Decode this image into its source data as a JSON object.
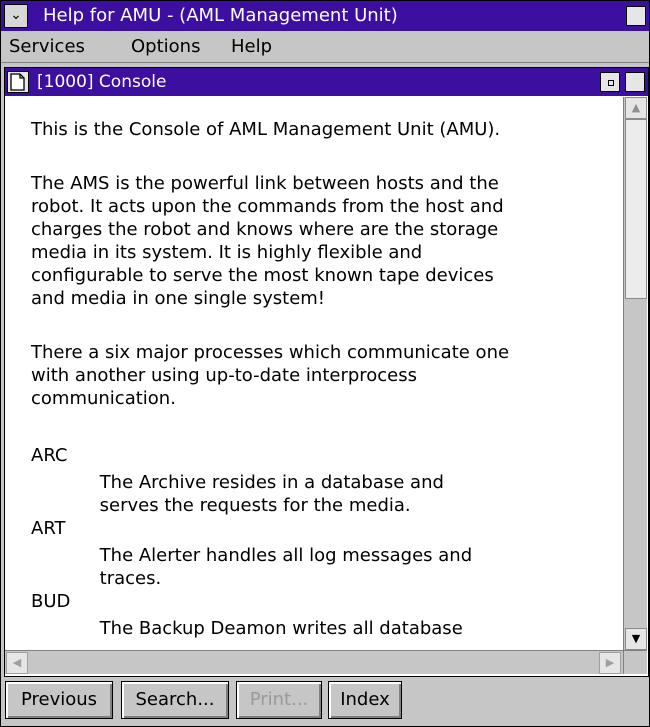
{
  "window": {
    "title": "Help for AMU - (AML Management Unit)"
  },
  "menubar": {
    "items": [
      "Services",
      "Options",
      "Help"
    ]
  },
  "help_window": {
    "title": "[1000]  Console",
    "paragraphs": [
      "This is the Console of AML Management Unit (AMU).",
      "The AMS is the powerful link between hosts and the",
      "robot. It acts upon the commands from the host and",
      "charges the robot and knows where are the storage",
      "media in its system. It is highly flexible and",
      "configurable to serve the most known tape devices",
      "and media in one single system!",
      "There a six major processes which communicate one",
      "with another using up-to-date interprocess",
      "communication.",
      "ARC",
      "            The Archive resides in a database and",
      "            serves the requests for the media.",
      "ART",
      "            The Alerter handles all log messages and",
      "            traces.",
      "BUD",
      "            The Backup Deamon writes all database"
    ]
  },
  "buttons": [
    {
      "label": "Previous",
      "enabled": true
    },
    {
      "label": "Search...",
      "enabled": true
    },
    {
      "label": "Print...",
      "enabled": false
    },
    {
      "label": "Index",
      "enabled": true
    }
  ],
  "icons": {
    "system_menu": "system-menu-icon",
    "maximize": "maximize-icon",
    "document": "document-icon",
    "minimize": "minimize-icon"
  }
}
